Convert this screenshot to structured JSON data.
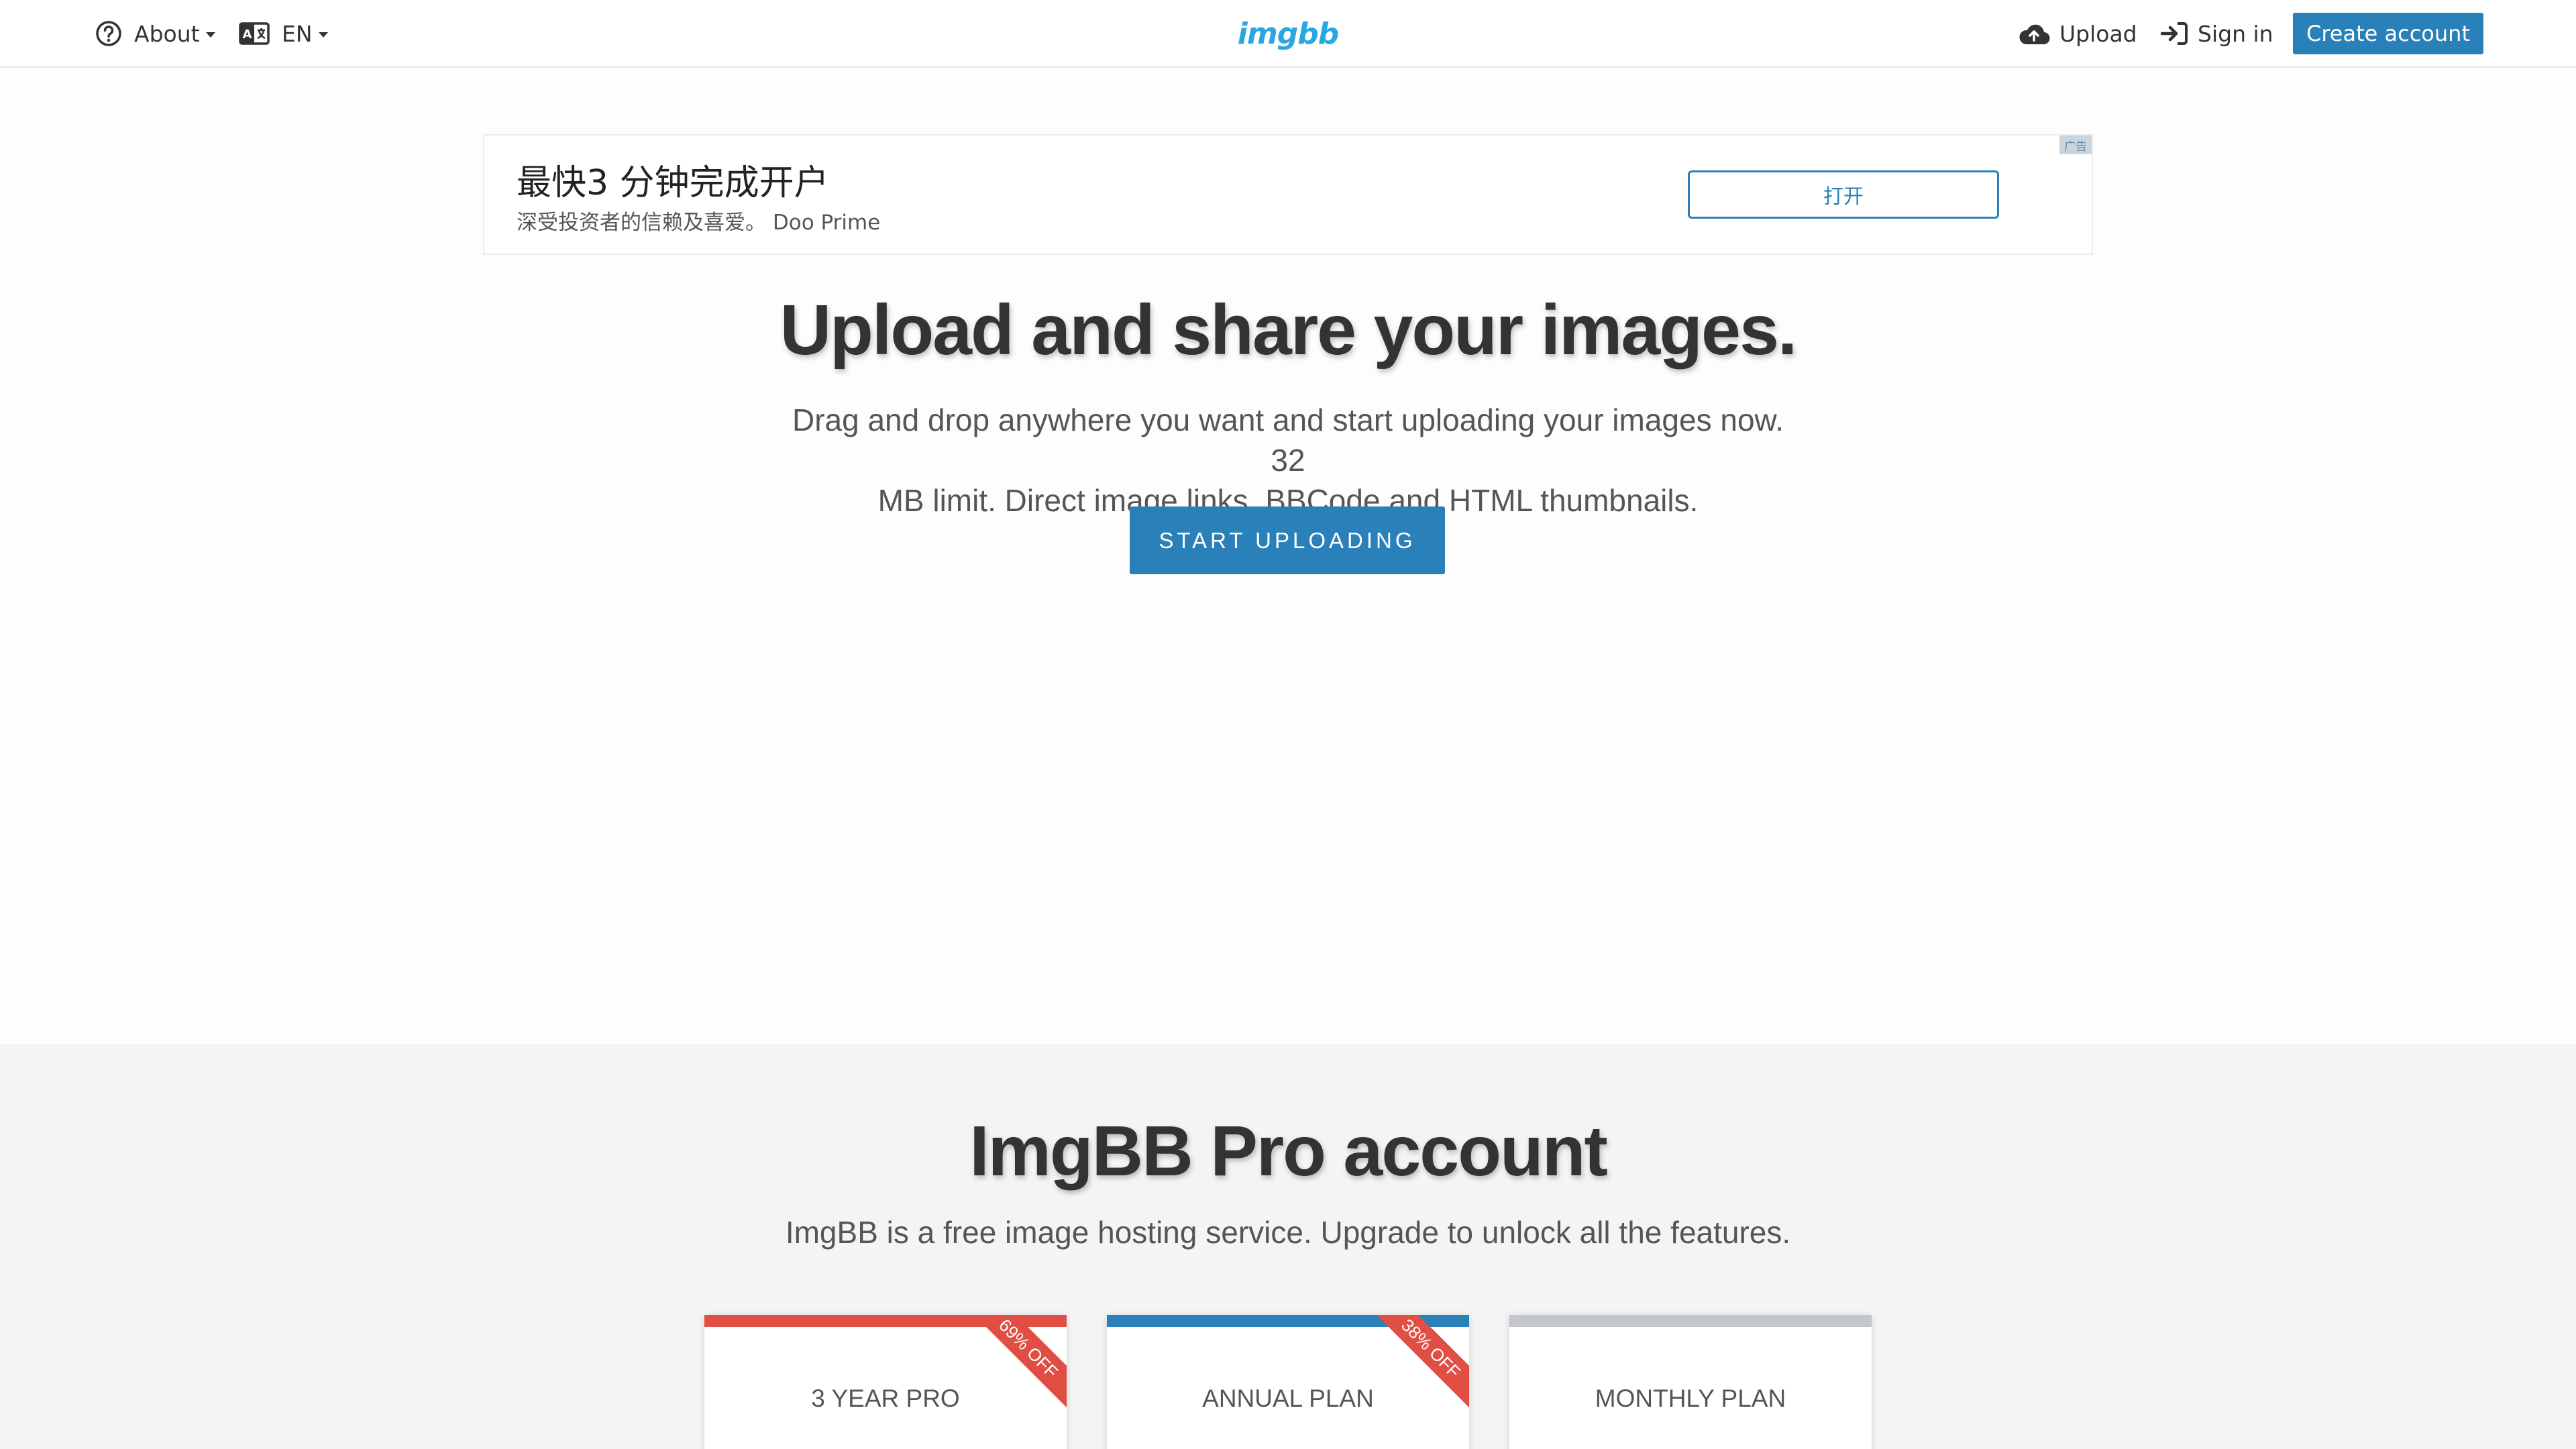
{
  "header": {
    "about_label": "About",
    "lang_label": "EN",
    "logo_text": "imgbb",
    "upload_label": "Upload",
    "signin_label": "Sign in",
    "create_label": "Create account"
  },
  "ad": {
    "title": "最快3 分钟完成开户",
    "subtitle": "深受投资者的信赖及喜爱。  Doo Prime",
    "button_label": "打开",
    "badge": "广告"
  },
  "hero": {
    "title": "Upload and share your images.",
    "description_line1": "Drag and drop anywhere you want and start uploading your images now. 32",
    "description_line2": "MB limit. Direct image links, BBCode and HTML thumbnails.",
    "button_label": "START UPLOADING"
  },
  "pro": {
    "title": "ImgBB Pro account",
    "description": "ImgBB is a free image hosting service. Upgrade to unlock all the features.",
    "plans": [
      {
        "name": "3 YEAR PRO",
        "ribbon": "69% OFF",
        "accent": "#e14e43"
      },
      {
        "name": "ANNUAL PLAN",
        "ribbon": "38% OFF",
        "accent": "#2a80b9"
      },
      {
        "name": "MONTHLY PLAN",
        "ribbon": "",
        "accent": "#c3c7cc"
      }
    ]
  },
  "colors": {
    "brand": "#2a80b9",
    "logo": "#2aa7e0",
    "ribbon": "#e14e43"
  },
  "icons": [
    "help-circle-icon",
    "language-icon",
    "cloud-upload-icon",
    "sign-in-icon"
  ]
}
